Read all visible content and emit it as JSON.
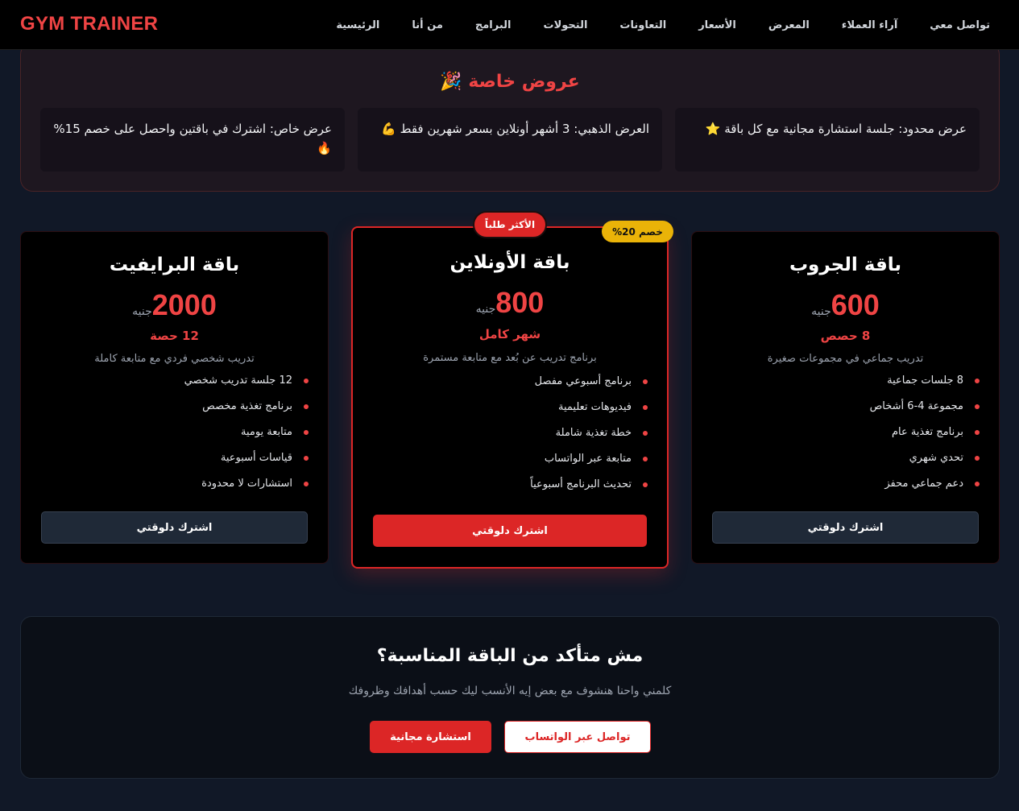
{
  "brand": "GYM TRAINER",
  "nav": {
    "items": [
      "تواصل معي",
      "آراء العملاء",
      "المعرض",
      "الأسعار",
      "التعاونات",
      "التحولات",
      "البرامج",
      "من أنا",
      "الرئيسية"
    ]
  },
  "offers": {
    "title": "عروض خاصة 🎉",
    "items": [
      {
        "text": "عرض محدود: جلسة استشارة مجانية مع كل باقة",
        "emoji": "⭐"
      },
      {
        "text": "العرض الذهبي: 3 أشهر أونلاين بسعر شهرين فقط",
        "emoji": "💪"
      },
      {
        "text": "عرض خاص: اشترك في باقتين واحصل على خصم 15%",
        "emoji": "🔥"
      }
    ]
  },
  "plans": {
    "group": {
      "name": "باقة الجروب",
      "price": "600",
      "currency": "جنيه",
      "period": "8 حصص",
      "desc": "تدريب جماعي في مجموعات صغيرة",
      "features": [
        "8 جلسات جماعية",
        "مجموعة 4-6 أشخاص",
        "برنامج تغذية عام",
        "تحدي شهري",
        "دعم جماعي محفز"
      ],
      "button": "اشترك دلوقتي"
    },
    "online": {
      "name": "باقة الأونلاين",
      "price": "800",
      "currency": "جنيه",
      "period": "شهر كامل",
      "desc": "برنامج تدريب عن بُعد مع متابعة مستمرة",
      "features": [
        "برنامج أسبوعي مفصل",
        "فيديوهات تعليمية",
        "خطة تغذية شاملة",
        "متابعة عبر الواتساب",
        "تحديث البرنامج أسبوعياً"
      ],
      "button": "اشترك دلوقتي",
      "badge_popular": "الأكثر طلباً",
      "badge_discount": "خصم 20%"
    },
    "private": {
      "name": "باقة البرايفيت",
      "price": "2000",
      "currency": "جنيه",
      "period": "12 حصة",
      "desc": "تدريب شخصي فردي مع متابعة كاملة",
      "features": [
        "12 جلسة تدريب شخصي",
        "برنامج تغذية مخصص",
        "متابعة يومية",
        "قياسات أسبوعية",
        "استشارات لا محدودة"
      ],
      "button": "اشترك دلوقتي"
    }
  },
  "cta": {
    "title": "مش متأكد من الباقة المناسبة؟",
    "subtitle": "كلمني واحنا هنشوف مع بعض إيه الأنسب ليك حسب أهدافك وظروفك",
    "whatsapp": "تواصل عبر الواتساب",
    "consult": "استشارة مجانية"
  },
  "colors": {
    "accent": "#dc2626",
    "accent_text": "#ef4444",
    "badge_yellow": "#eab308",
    "background": "#111827"
  }
}
